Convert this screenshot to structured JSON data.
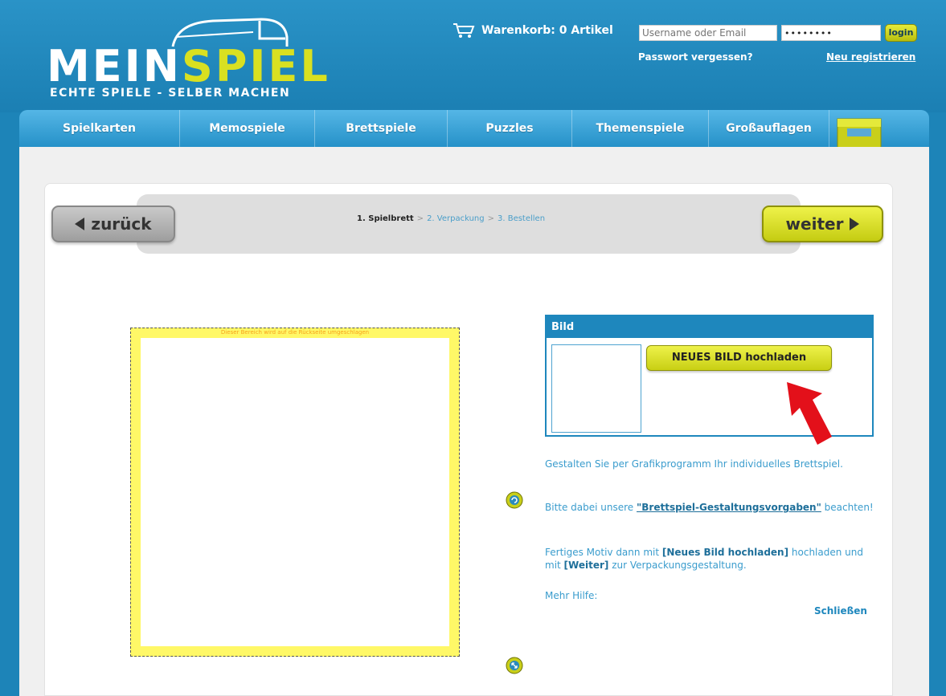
{
  "header": {
    "logo_main_white": "MEIN",
    "logo_main_yellow": "SPIEL",
    "logo_tagline": "ECHTE SPIELE - SELBER MACHEN",
    "cart_label": "Warenkorb: 0 Artikel",
    "username_placeholder": "Username oder Email",
    "password_value": "••••••••",
    "login_label": "login",
    "forgot_password": "Passwort vergessen?",
    "register": "Neu registrieren"
  },
  "nav": {
    "items": [
      {
        "label": "Spielkarten"
      },
      {
        "label": "Memospiele"
      },
      {
        "label": "Brettspiele"
      },
      {
        "label": "Puzzles"
      },
      {
        "label": "Themenspiele"
      },
      {
        "label": "Großauflagen"
      }
    ]
  },
  "wizard": {
    "back_label": "zurück",
    "next_label": "weiter",
    "steps": [
      {
        "label": "1. Spielbrett"
      },
      {
        "label": "2. Verpackung"
      },
      {
        "label": "3. Bestellen"
      }
    ],
    "separator": ">"
  },
  "board": {
    "note": "Dieser Bereich wird auf die Rückseite umgeschlagen"
  },
  "bild": {
    "title": "Bild",
    "upload_label": "NEUES BILD hochladen"
  },
  "help": {
    "p1": "Gestalten Sie per Grafikprogramm Ihr individuelles Brettspiel.",
    "p2_before": "Bitte dabei unsere ",
    "p2_link": "\"Brettspiel-Gestaltungsvorgaben\"",
    "p2_after": " beachten!",
    "p3_a": "Fertiges Motiv dann mit ",
    "p3_b": "[Neues Bild hochladen]",
    "p3_c": " hochladen und mit ",
    "p3_d": "[Weiter]",
    "p3_e": " zur Verpackungsgestaltung.",
    "p4": "Mehr Hilfe:",
    "close": "Schließen"
  },
  "colors": {
    "brand_blue": "#1d84b8",
    "accent_yellow": "#d9e021",
    "board_yellow": "#fff867"
  }
}
